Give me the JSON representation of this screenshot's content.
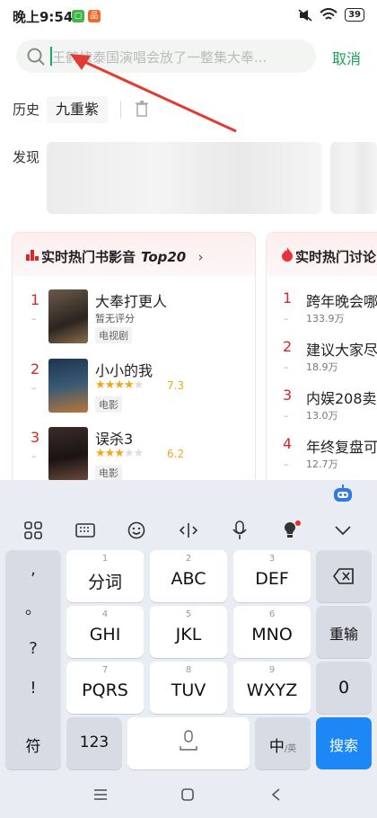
{
  "status_bar": {
    "time": "晚上9:54",
    "battery": "39"
  },
  "search": {
    "placeholder": "王鹤棣泰国演唱会放了一整集大奉...",
    "cancel_label": "取消"
  },
  "history": {
    "label": "历史",
    "items": [
      "九重紫"
    ]
  },
  "discover": {
    "label": "发现"
  },
  "movies_card": {
    "title": "实时热门书影音",
    "badge": "Top20",
    "items": [
      {
        "rank": "1",
        "title": "大奉打更人",
        "rating_text": "暂无评分",
        "tag": "电视剧"
      },
      {
        "rank": "2",
        "title": "小小的我",
        "score": "7.3",
        "stars": 3.5,
        "tag": "电影"
      },
      {
        "rank": "3",
        "title": "误杀3",
        "score": "6.2",
        "stars": 3,
        "tag": "电影"
      }
    ]
  },
  "discussion_card": {
    "title": "实时热门讨论",
    "items": [
      {
        "rank": "1",
        "title": "跨年晚会哪",
        "count": "133.9万"
      },
      {
        "rank": "2",
        "title": "建议大家尽",
        "count": "18.9万"
      },
      {
        "rank": "3",
        "title": "内娱208卖",
        "count": "13.0万"
      },
      {
        "rank": "4",
        "title": "年终复盘可",
        "count": "12.7万"
      }
    ]
  },
  "keyboard": {
    "side_symbols": [
      ",",
      "。",
      "?",
      "!"
    ],
    "keys": [
      {
        "num": "1",
        "label": "分词"
      },
      {
        "num": "2",
        "label": "ABC"
      },
      {
        "num": "3",
        "label": "DEF"
      },
      {
        "num": "4",
        "label": "GHI"
      },
      {
        "num": "5",
        "label": "JKL"
      },
      {
        "num": "6",
        "label": "MNO"
      },
      {
        "num": "7",
        "label": "PQRS"
      },
      {
        "num": "8",
        "label": "TUV"
      },
      {
        "num": "9",
        "label": "WXYZ"
      }
    ],
    "reenter_label": "重输",
    "zero_label": "0",
    "symbol_label": "符",
    "num_label": "123",
    "lang_label": "中",
    "lang_sub": "/英",
    "search_label": "搜索"
  },
  "colors": {
    "accent_green": "#1fa255",
    "rank_red": "#d8262c",
    "star": "#f0a71a",
    "search_key": "#1d87f5"
  }
}
